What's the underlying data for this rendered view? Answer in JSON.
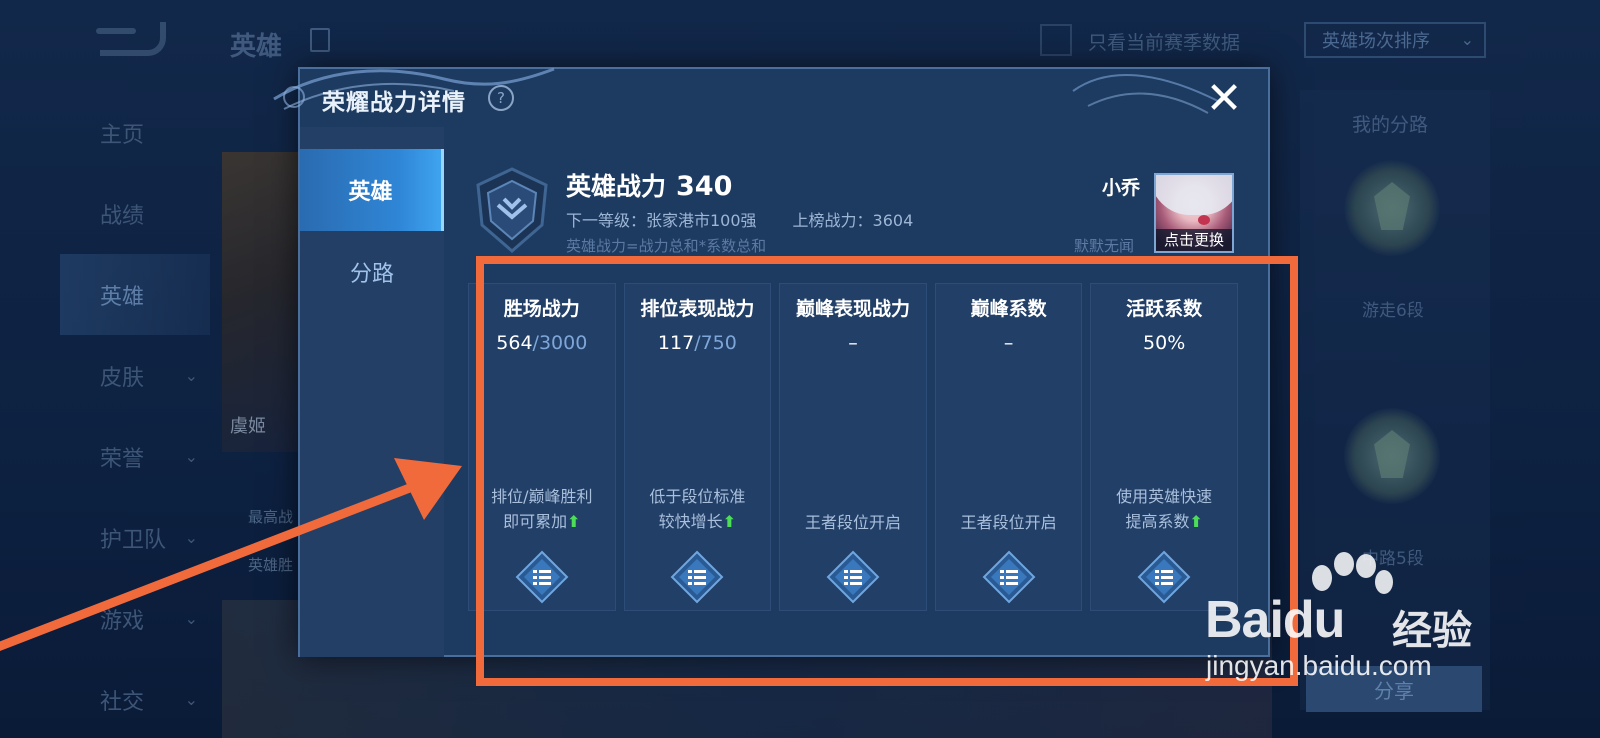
{
  "background": {
    "page_title": "英雄",
    "nav_items": [
      {
        "label": "主页"
      },
      {
        "label": "战绩"
      },
      {
        "label": "英雄"
      },
      {
        "label": "皮肤"
      },
      {
        "label": "荣誉"
      },
      {
        "label": "护卫队"
      },
      {
        "label": "游戏"
      },
      {
        "label": "社交"
      }
    ],
    "season_filter_label": "只看当前赛季数据",
    "sort_select": "英雄场次排序",
    "hero_card_name": "虞姬",
    "under_text_1": "最高战",
    "under_text_2": "英雄胜",
    "right_panel_title": "我的分路",
    "lane_1": "游走6段",
    "lane_2": "中路5段",
    "share_button": "分享"
  },
  "dialog": {
    "title": "荣耀战力详情",
    "help_icon": "?",
    "close_icon": "✕",
    "tabs": [
      {
        "label": "英雄"
      },
      {
        "label": "分路"
      }
    ],
    "power_label": "英雄战力",
    "power_value": "340",
    "next_level": "下一等级：张家港市100强",
    "rank_power": "上榜战力：3604",
    "formula": "英雄战力=战力总和*系数总和",
    "hero_name": "小乔",
    "hero_note": "默默无闻",
    "change_button": "点击更换",
    "stats": [
      {
        "title": "胜场战力",
        "current": "564",
        "max": "/3000",
        "desc1": "排位/巅峰胜利",
        "desc2": "即可累加",
        "arrow": "⬆"
      },
      {
        "title": "排位表现战力",
        "current": "117",
        "max": "/750",
        "desc1": "低于段位标准",
        "desc2": "较快增长",
        "arrow": "⬆"
      },
      {
        "title": "巅峰表现战力",
        "current": "–",
        "max": "",
        "desc1": "",
        "desc2": "王者段位开启",
        "arrow": ""
      },
      {
        "title": "巅峰系数",
        "current": "–",
        "max": "",
        "desc1": "",
        "desc2": "王者段位开启",
        "arrow": ""
      },
      {
        "title": "活跃系数",
        "current": "50%",
        "max": "",
        "desc1": "使用英雄快速",
        "desc2": "提高系数",
        "arrow": "⬆"
      }
    ]
  },
  "watermark": {
    "brand": "Bai",
    "brand2": "du",
    "brand3": "经验",
    "url": "jingyan.baidu.com"
  },
  "colors": {
    "annotation": "#f06a3c",
    "active_tab": "#2f86d6",
    "arrow_up": "#4ddd59"
  }
}
